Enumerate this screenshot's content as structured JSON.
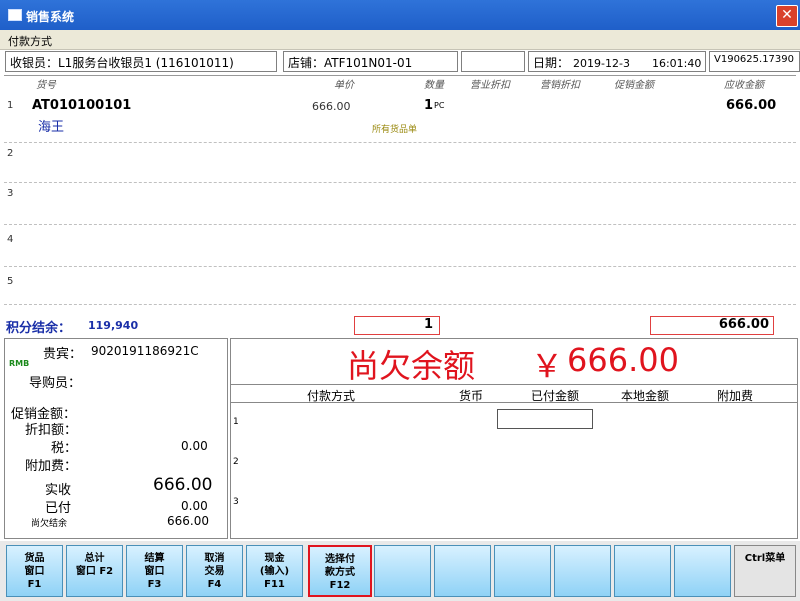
{
  "window": {
    "title": "销售系统",
    "close_symbol": "✕"
  },
  "menubar": {
    "label": "付款方式"
  },
  "info": {
    "cashier": "收银员：L1服务台收银员1 (116101011)",
    "store": "店铺：ATF101N01-01",
    "blank1": "",
    "date_label": "日期：",
    "date_value": "2019-12-3",
    "time_value": "16:01:40",
    "version": "V190625.17390"
  },
  "grid": {
    "headers": [
      "货号",
      "单价",
      "数量",
      "营业折扣",
      "营销折扣",
      "促销金额",
      "应收金额"
    ],
    "items": [
      {
        "num": "1",
        "code": "AT010100101",
        "name": "海王",
        "price": "666.00",
        "qty": "1",
        "unit": "PC",
        "note": "所有货品单",
        "amount": "666.00"
      }
    ],
    "row_numbers": [
      "2",
      "3",
      "4",
      "5"
    ]
  },
  "balance": {
    "label": "积分结余：",
    "value": "119,940",
    "qty_total": "1",
    "amount_total": "666.00"
  },
  "left": {
    "guest_label": "贵宾：",
    "guest_value": "9020191186921C",
    "rmb": "RMB",
    "guide_label": "导购员：",
    "promo_label": "促销金额：",
    "discount_label": "折扣额：",
    "tax_label": "税：",
    "tax_value": "0.00",
    "surcharge_label": "附加费：",
    "actual_label": "实收",
    "actual_value": "666.00",
    "paid_label": "已付",
    "paid_value": "0.00",
    "owed_label": "尚欠结余",
    "owed_value": "666.00"
  },
  "banner": {
    "text": "尚欠余额",
    "currency": "￥",
    "amount": "666.00"
  },
  "payments": {
    "headers": [
      "付款方式",
      "货币",
      "已付金额",
      "本地金额",
      "附加费"
    ],
    "row_numbers": [
      "1",
      "2",
      "3"
    ]
  },
  "buttons": [
    {
      "l1": "货品",
      "l2": "窗口",
      "key": "F1"
    },
    {
      "l1": "总计",
      "l2": "窗口 F2",
      "key": ""
    },
    {
      "l1": "结算",
      "l2": "窗口",
      "key": "F3"
    },
    {
      "l1": "取消",
      "l2": "交易",
      "key": "F4"
    },
    {
      "l1": "现金",
      "l2": "(输入)",
      "key": "F11"
    },
    {
      "l1": "选择付",
      "l2": "款方式",
      "key": "F12"
    }
  ],
  "ctrl_menu": "Ctrl菜单",
  "colors": {
    "title_blue": "#1f5fc9",
    "banner_red": "#e0141e",
    "button_blue": "#8fd2f6",
    "panel_border": "#1a3a8a"
  }
}
